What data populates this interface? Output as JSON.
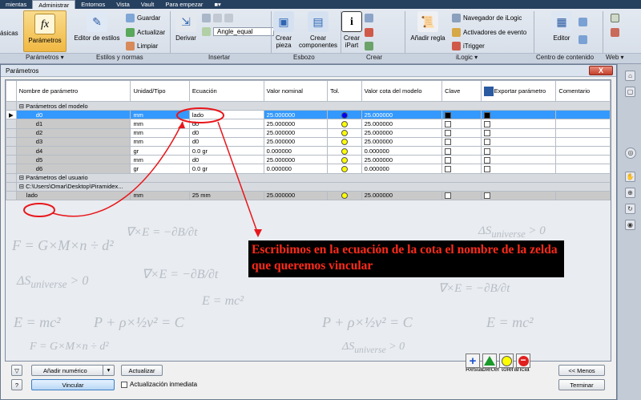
{
  "ribbon": {
    "tabs": [
      "mientas",
      "Administrar",
      "Entornos",
      "Vista",
      "Vault",
      "Para empezar"
    ],
    "active_tab": "Administrar",
    "basicas_label": "ásicas",
    "parametros_button": "Parámetros",
    "editor_estilos": "Editor de estilos",
    "guardar": "Guardar",
    "actualizar": "Actualizar",
    "limpiar": "Limpiar",
    "derivar": "Derivar",
    "angle_dropdown": "Angle_equal",
    "crear_pieza": "Crear pieza",
    "crear_componentes": "Crear componentes",
    "crear_ipart": "Crear iPart",
    "anadir_regla": "Añadir regla",
    "navegador_ilogic": "Navegador de iLogic",
    "activadores_evento": "Activadores de evento",
    "itrigger": "iTrigger",
    "editor": "Editor",
    "groups": {
      "parametros": "Parámetros",
      "estilos": "Estilos y normas",
      "insertar": "Insertar",
      "esbozo": "Esbozo",
      "crear": "Crear",
      "ilogic": "iLogic",
      "centro": "Centro de contenido",
      "web": "Web"
    }
  },
  "dialog": {
    "title": "Parámetros",
    "close": "X",
    "columns": [
      "Nombre de parámetro",
      "Unidad/Tipo",
      "Ecuación",
      "Valor nominal",
      "Tol.",
      "Valor cota del modelo",
      "Clave",
      "Exportar parámetro",
      "Comentario"
    ],
    "model_group": "Parámetros del modelo",
    "rows": [
      {
        "name": "d0",
        "unit": "mm",
        "equation": "lado",
        "nominal": "25.000000",
        "tol": "blue",
        "model": "25.000000",
        "key": true,
        "export": true
      },
      {
        "name": "d1",
        "unit": "mm",
        "equation": "d0",
        "nominal": "25.000000",
        "tol": "yellow",
        "model": "25.000000",
        "key": false,
        "export": false
      },
      {
        "name": "d2",
        "unit": "mm",
        "equation": "d0",
        "nominal": "25.000000",
        "tol": "yellow",
        "model": "25.000000",
        "key": false,
        "export": false
      },
      {
        "name": "d3",
        "unit": "mm",
        "equation": "d0",
        "nominal": "25.000000",
        "tol": "yellow",
        "model": "25.000000",
        "key": false,
        "export": false
      },
      {
        "name": "d4",
        "unit": "gr",
        "equation": "0.0 gr",
        "nominal": "0.000000",
        "tol": "yellow",
        "model": "0.000000",
        "key": false,
        "export": false
      },
      {
        "name": "d5",
        "unit": "mm",
        "equation": "d0",
        "nominal": "25.000000",
        "tol": "yellow",
        "model": "25.000000",
        "key": false,
        "export": false
      },
      {
        "name": "d6",
        "unit": "gr",
        "equation": "0.0 gr",
        "nominal": "0.000000",
        "tol": "yellow",
        "model": "0.000000",
        "key": false,
        "export": false
      }
    ],
    "user_group": "Parámetros del usuario",
    "path_row": "C:\\Users\\Omar\\Desktop\\Piramidex...",
    "user_rows": [
      {
        "name": "lado",
        "unit": "mm",
        "equation": "25 mm",
        "nominal": "25.000000",
        "tol": "yellow",
        "model": "25.000000",
        "key": false,
        "export": false
      }
    ],
    "annotation": "Escribimos en la ecuación de la cota el nombre de la zelda que queremos vincular",
    "bottom": {
      "add_numeric": "Añadir numérico",
      "update": "Actualizar",
      "link": "Vincular",
      "immediate_update": "Actualización inmediata",
      "reset_tolerance": "Restablecer tolerancia",
      "less": "<< Menos",
      "finish": "Terminar"
    }
  },
  "colors": {
    "selected_row": "#3399ff",
    "annotation_text": "#ff2a1a",
    "annotation_bg": "#000000",
    "circle_annotation": "#e8161b"
  }
}
